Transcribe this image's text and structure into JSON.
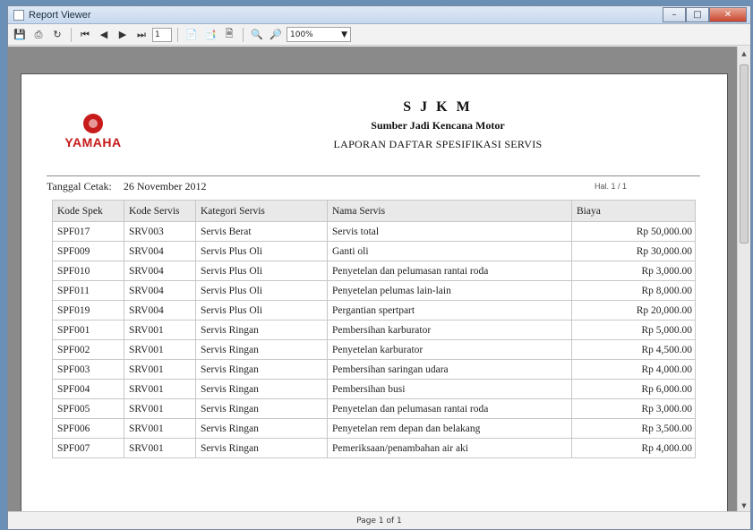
{
  "window": {
    "title": "Report Viewer"
  },
  "toolbar": {
    "page_input": "1",
    "zoom": "100%",
    "icons": [
      "save-icon",
      "print-icon",
      "refresh-icon",
      "first-page-icon",
      "prev-page-icon",
      "next-page-icon",
      "last-page-icon",
      "page-setup-icon",
      "print-layout-icon",
      "export-icon",
      "zoom-in-icon",
      "zoom-out-icon"
    ]
  },
  "report": {
    "logo_text": "YAMAHA",
    "company_short": "S J K M",
    "company_name": "Sumber Jadi Kencana Motor",
    "report_title": "LAPORAN DAFTAR SPESIFIKASI SERVIS",
    "print_date_label": "Tanggal Cetak:",
    "print_date_value": "26 November 2012",
    "page_no": "Hal. 1 / 1",
    "columns": [
      "Kode Spek",
      "Kode Servis",
      "Kategori Servis",
      "Nama Servis",
      "Biaya"
    ],
    "rows": [
      [
        "SPF017",
        "SRV003",
        "Servis Berat",
        "Servis total",
        "Rp 50,000.00"
      ],
      [
        "SPF009",
        "SRV004",
        "Servis Plus Oli",
        "Ganti oli",
        "Rp 30,000.00"
      ],
      [
        "SPF010",
        "SRV004",
        "Servis Plus Oli",
        "Penyetelan dan pelumasan rantai roda",
        "Rp 3,000.00"
      ],
      [
        "SPF011",
        "SRV004",
        "Servis Plus Oli",
        "Penyetelan pelumas lain-lain",
        "Rp 8,000.00"
      ],
      [
        "SPF019",
        "SRV004",
        "Servis Plus Oli",
        "Pergantian spertpart",
        "Rp 20,000.00"
      ],
      [
        "SPF001",
        "SRV001",
        "Servis Ringan",
        "Pembersihan karburator",
        "Rp 5,000.00"
      ],
      [
        "SPF002",
        "SRV001",
        "Servis Ringan",
        "Penyetelan karburator",
        "Rp 4,500.00"
      ],
      [
        "SPF003",
        "SRV001",
        "Servis Ringan",
        "Pembersihan saringan udara",
        "Rp 4,000.00"
      ],
      [
        "SPF004",
        "SRV001",
        "Servis Ringan",
        "Pembersihan busi",
        "Rp 6,000.00"
      ],
      [
        "SPF005",
        "SRV001",
        "Servis Ringan",
        "Penyetelan dan pelumasan rantai roda",
        "Rp 3,000.00"
      ],
      [
        "SPF006",
        "SRV001",
        "Servis Ringan",
        "Penyetelan rem depan dan belakang",
        "Rp 3,500.00"
      ],
      [
        "SPF007",
        "SRV001",
        "Servis Ringan",
        "Pemeriksaan/penambahan air aki",
        "Rp 4,000.00"
      ]
    ]
  },
  "status": {
    "page_indicator": "Page 1 of 1"
  },
  "colors": {
    "brand": "#c71a1a",
    "viewer_bg": "#8a8a8a"
  }
}
